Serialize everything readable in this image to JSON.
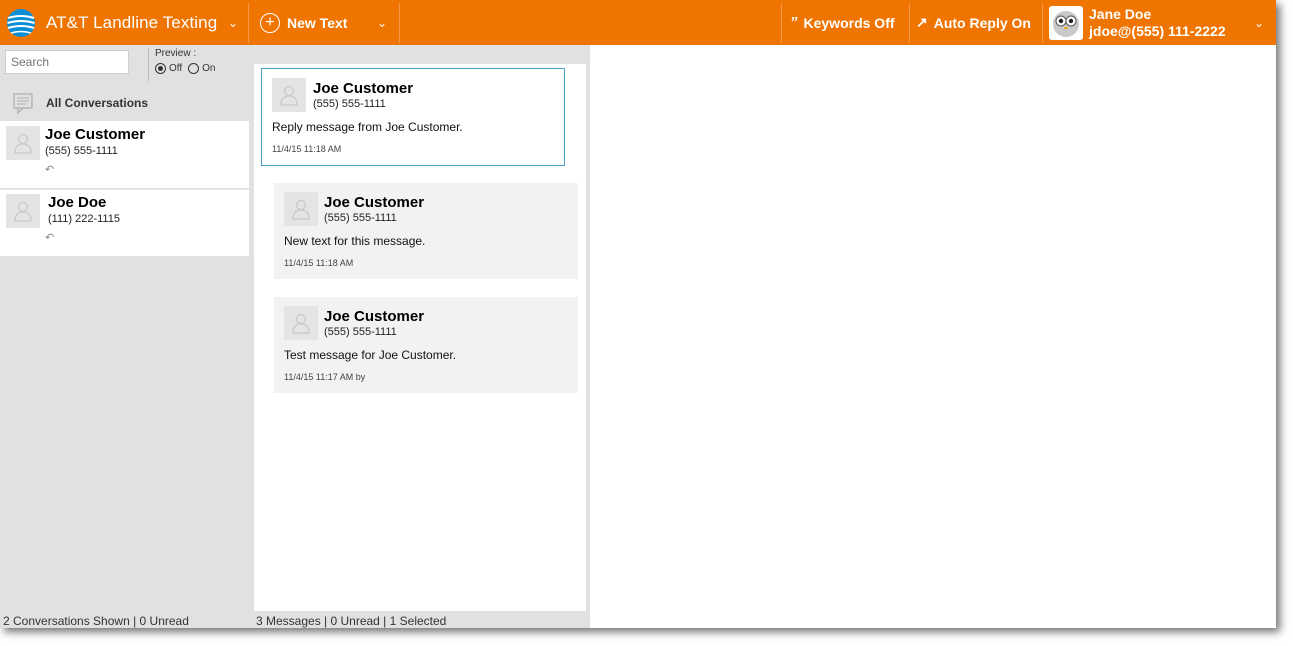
{
  "topbar": {
    "app_title": "AT&T Landline Texting",
    "new_text_label": "New Text",
    "keywords_label": "Keywords Off",
    "auto_reply_label": "Auto Reply On",
    "user_name": "Jane Doe",
    "user_account": "jdoe@(555) 111-2222",
    "brand_color": "#f07400"
  },
  "sidebar": {
    "search_placeholder": "Search",
    "preview_label": "Preview :",
    "preview_off": "Off",
    "preview_on": "On",
    "preview_selected": "Off",
    "all_conversations": "All Conversations",
    "conversations": [
      {
        "name": "Joe Customer",
        "phone": "(555) 555-1111"
      },
      {
        "name": "Joe Doe",
        "phone": "(111) 222-1115"
      }
    ],
    "status": "2 Conversations Shown | 0 Unread"
  },
  "messages": {
    "items": [
      {
        "name": "Joe Customer",
        "phone": "(555) 555-1111",
        "text": "Reply message from Joe Customer.",
        "time": "11/4/15 11:18 AM",
        "selected": true
      },
      {
        "name": "Joe Customer",
        "phone": "(555) 555-1111",
        "text": "New text for this message.",
        "time": "11/4/15 11:18 AM",
        "selected": false
      },
      {
        "name": "Joe Customer",
        "phone": "(555) 555-1111",
        "text": "Test message for Joe Customer.",
        "time": "11/4/15 11:17 AM by",
        "selected": false
      }
    ],
    "status": "3 Messages | 0 Unread | 1 Selected"
  }
}
